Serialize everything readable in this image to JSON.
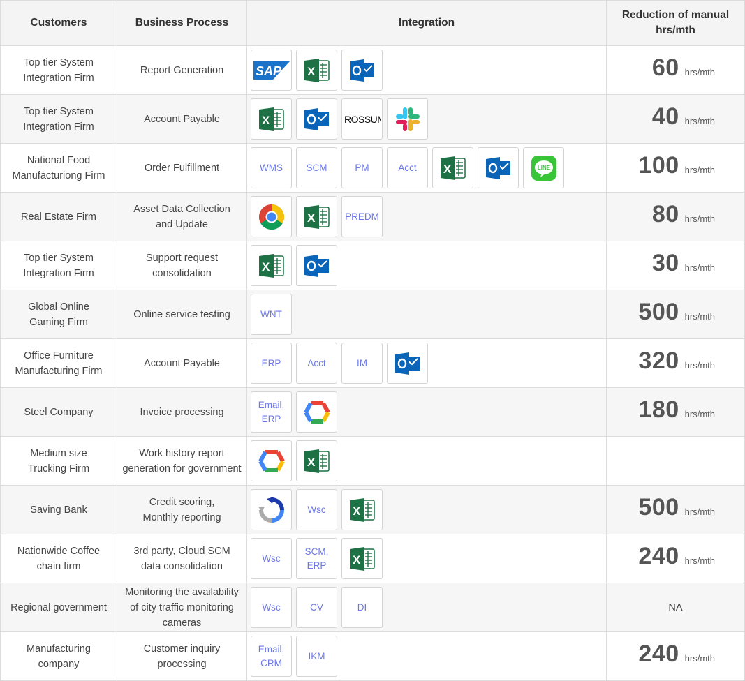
{
  "headers": {
    "customers": "Customers",
    "process": "Business Process",
    "integration": "Integration",
    "reduction": "Reduction of manual\nhrs/mth"
  },
  "unit_label": "hrs/mth",
  "rows": [
    {
      "customer": "Top tier System\nIntegration Firm",
      "process": "Report Generation",
      "tools": [
        "sap-icon",
        "excel-icon",
        "outlook-icon"
      ],
      "value": "60",
      "unit": "hrs/mth",
      "na": ""
    },
    {
      "customer": "Top tier System\nIntegration Firm",
      "process": "Account Payable",
      "tools": [
        "excel-icon",
        "outlook-icon",
        "rossum-icon",
        "slack-icon"
      ],
      "value": "40",
      "unit": "hrs/mth",
      "na": ""
    },
    {
      "customer": "National Food\nManufacturiong Firm",
      "process": "Order Fulfillment",
      "tools": [
        "WMS",
        "SCM",
        "PM",
        "Acct",
        "excel-icon",
        "outlook-icon",
        "line-icon"
      ],
      "value": "100",
      "unit": "hrs/mth",
      "na": ""
    },
    {
      "customer": "Real Estate Firm",
      "process": "Asset Data Collection\nand Update",
      "tools": [
        "chrome-icon",
        "excel-icon",
        "PREDM"
      ],
      "value": "80",
      "unit": "hrs/mth",
      "na": ""
    },
    {
      "customer": "Top tier System\nIntegration Firm",
      "process": "Support request\nconsolidation",
      "tools": [
        "excel-icon",
        "outlook-icon"
      ],
      "value": "30",
      "unit": "hrs/mth",
      "na": ""
    },
    {
      "customer": "Global Online\nGaming Firm",
      "process": "Online service testing",
      "tools": [
        "WNT"
      ],
      "value": "500",
      "unit": "hrs/mth",
      "na": ""
    },
    {
      "customer": "Office Furniture\nManufacturing Firm",
      "process": "Account Payable",
      "tools": [
        "ERP",
        "Acct",
        "IM",
        "outlook-icon"
      ],
      "value": "320",
      "unit": "hrs/mth",
      "na": ""
    },
    {
      "customer": "Steel Company",
      "process": "Invoice processing",
      "tools": [
        "Email,\nERP",
        "google-cloud-icon"
      ],
      "value": "180",
      "unit": "hrs/mth",
      "na": ""
    },
    {
      "customer": "Medium size\nTrucking Firm",
      "process": "Work history report\ngeneration for government",
      "tools": [
        "google-cloud-icon",
        "excel-icon"
      ],
      "value": "",
      "unit": "",
      "na": ""
    },
    {
      "customer": "Saving Bank",
      "process": "Credit scoring,\nMonthly reporting",
      "tools": [
        "recaptcha-icon",
        "Wsc",
        "excel-icon"
      ],
      "value": "500",
      "unit": "hrs/mth",
      "na": ""
    },
    {
      "customer": "Nationwide Coffee\nchain firm",
      "process": "3rd party, Cloud SCM\ndata consolidation",
      "tools": [
        "Wsc",
        "SCM,\nERP",
        "excel-icon"
      ],
      "value": "240",
      "unit": "hrs/mth",
      "na": ""
    },
    {
      "customer": "Regional government",
      "process": "Monitoring the availability\nof city traffic monitoring\ncameras",
      "tools": [
        "Wsc",
        "CV",
        "DI"
      ],
      "value": "",
      "unit": "",
      "na": "NA"
    },
    {
      "customer": "Manufacturing\ncompany",
      "process": "Customer inquiry\nprocessing",
      "tools": [
        "Email,\nCRM",
        "IKM"
      ],
      "value": "240",
      "unit": "hrs/mth",
      "na": ""
    }
  ],
  "icon_text": {
    "sap": "SAP",
    "excel": "X",
    "outlook": "O",
    "rossum": "ROSSUM",
    "line": "LINE"
  },
  "colors": {
    "excel_green": "#1d7144",
    "outlook_blue": "#0a64b8",
    "sap_blue": "#1a73c9",
    "tile_text": "#6b78e6",
    "header_bg": "#f4f4f4"
  }
}
